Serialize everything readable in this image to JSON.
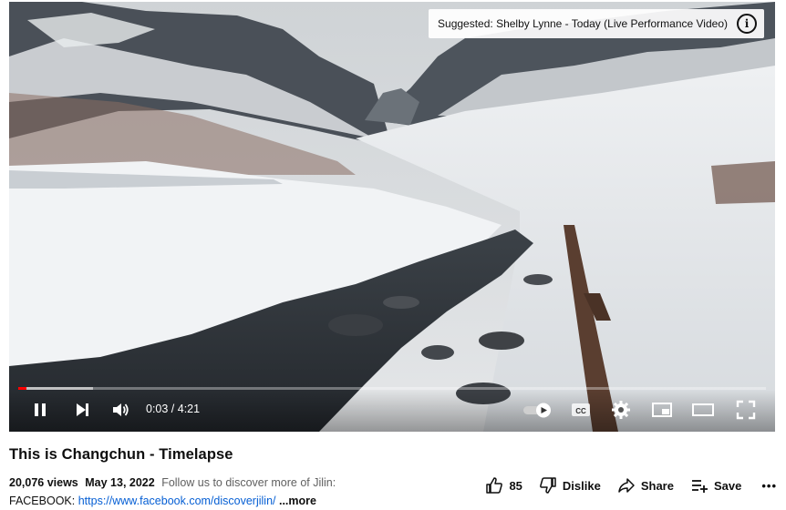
{
  "player": {
    "suggested_text": "Suggested: Shelby Lynne - Today (Live Performance Video)",
    "info_symbol": "i",
    "current_time": "0:03",
    "duration": "4:21",
    "time_display": "0:03 / 4:21",
    "progress_fraction": 0.0115,
    "buffered_fraction": 0.1,
    "autoplay_on": true,
    "cc_label": "CC",
    "icons": [
      "pause-icon",
      "next-icon",
      "volume-icon",
      "autoplay-toggle",
      "captions-icon",
      "settings-gear-icon",
      "miniplayer-icon",
      "theater-mode-icon",
      "fullscreen-icon"
    ],
    "accent_color": "#ff0000"
  },
  "video": {
    "title": "This is Changchun - Timelapse",
    "views": "20,076 views",
    "date": "May 13, 2022",
    "description_line1": "Follow us to discover more of Jilin:",
    "description_line2_prefix": "FACEBOOK:",
    "description_link": "https://www.facebook.com/discoverjilin/",
    "more_label": "...more"
  },
  "actions": {
    "like_count": "85",
    "dislike_label": "Dislike",
    "share_label": "Share",
    "save_label": "Save",
    "more_symbol": "•••"
  }
}
